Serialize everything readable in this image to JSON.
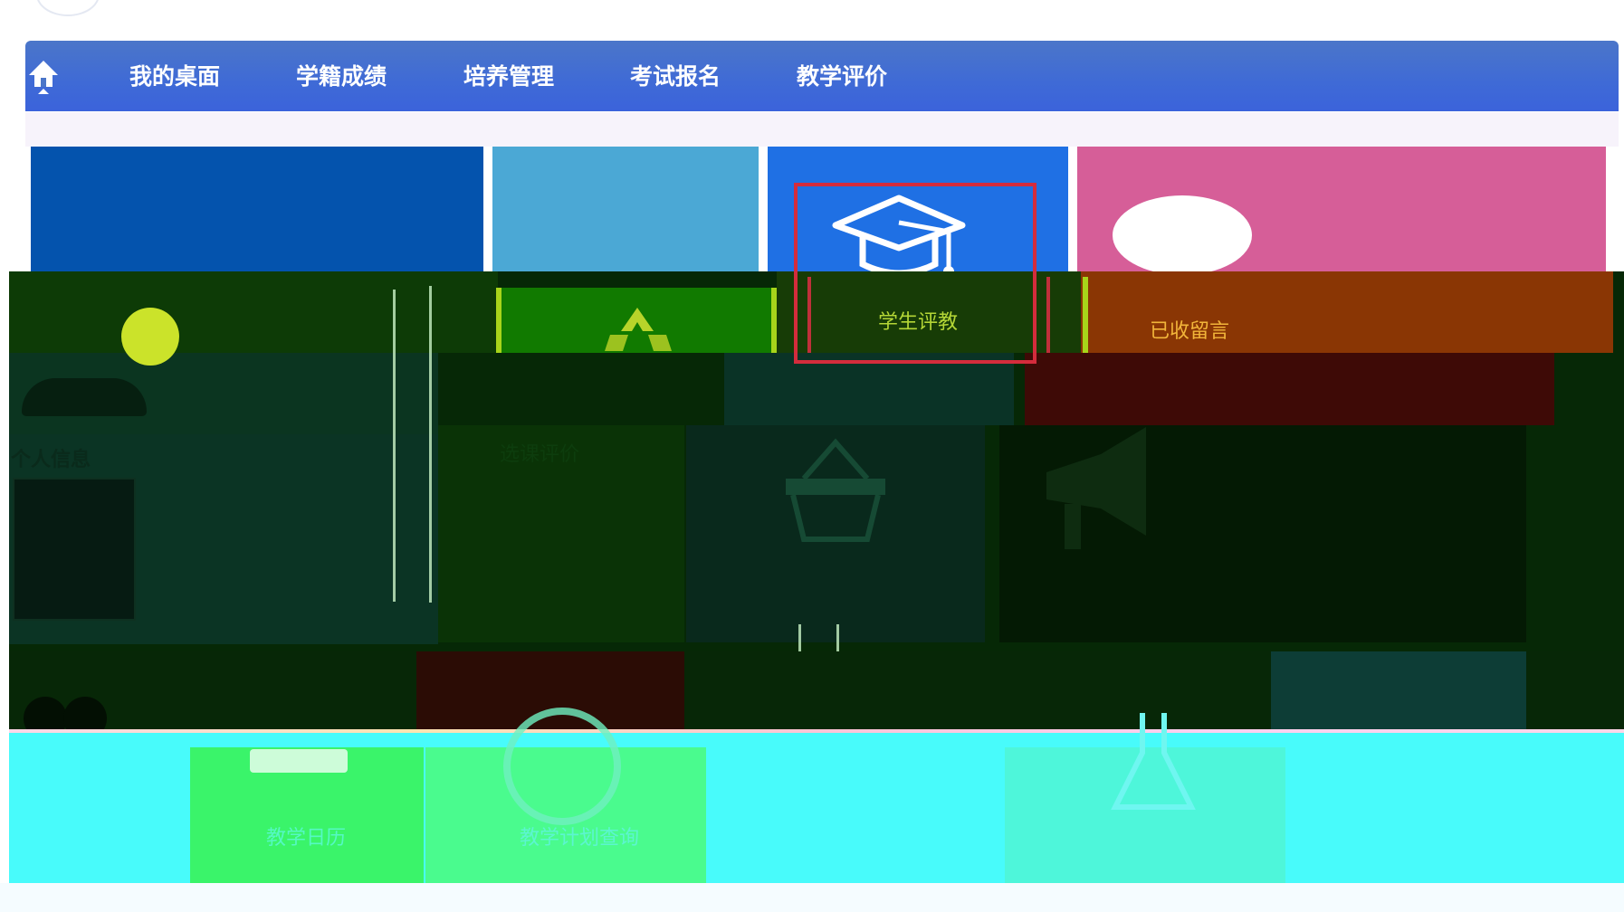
{
  "nav": {
    "items": [
      "我的桌面",
      "学籍成绩",
      "培养管理",
      "考试报名",
      "教学评价"
    ]
  },
  "tiles": {
    "student_evaluation": "学生评教",
    "received_messages": "已收留言",
    "personal_info": "个人信息",
    "course_evaluation": "选课评价",
    "teaching_calendar": "教学日历",
    "teaching_plan": "教学计划查询"
  },
  "icons": {
    "home": "home-icon",
    "graduation": "graduation-cap-icon",
    "chat": "chat-bubble-icon",
    "recycle": "recycle-icon",
    "basket": "basket-icon",
    "megaphone": "megaphone-icon"
  },
  "colors": {
    "nav_bar": "#3f6ad6",
    "tile_dark_blue": "#0453ad",
    "tile_light_blue": "#4ba8d5",
    "tile_blue": "#1f70e4",
    "tile_pink": "#d65e98",
    "highlight_frame": "#d42c3c"
  }
}
